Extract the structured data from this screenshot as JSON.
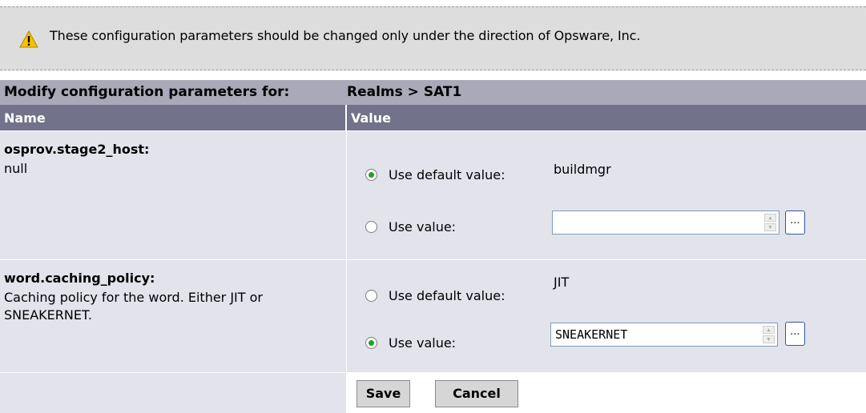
{
  "warning": {
    "text": "These configuration parameters should be changed only under the direction of Opsware, Inc.",
    "icon": "warning-icon"
  },
  "header": {
    "label": "Modify configuration parameters for:",
    "path": "Realms > SAT1"
  },
  "columns": {
    "name": "Name",
    "value": "Value"
  },
  "params": [
    {
      "name": "osprov.stage2_host:",
      "description": "null",
      "default_label": "Use default value:",
      "default_value": "buildmgr",
      "use_value_label": "Use value:",
      "value": "",
      "selected": "default"
    },
    {
      "name": "word.caching_policy:",
      "description": "Caching policy for the word. Either JIT or SNEAKERNET.",
      "default_label": "Use default value:",
      "default_value": "JIT",
      "use_value_label": "Use value:",
      "value": "SNEAKERNET",
      "selected": "value"
    }
  ],
  "buttons": {
    "browse": "...",
    "save": "Save",
    "cancel": "Cancel"
  },
  "colors": {
    "warning_bg": "#dddddd",
    "header_bg": "#a9a9b9",
    "column_header_bg": "#72728a",
    "row_bg": "#e3e3ec",
    "radio_checked": "#21a121"
  }
}
